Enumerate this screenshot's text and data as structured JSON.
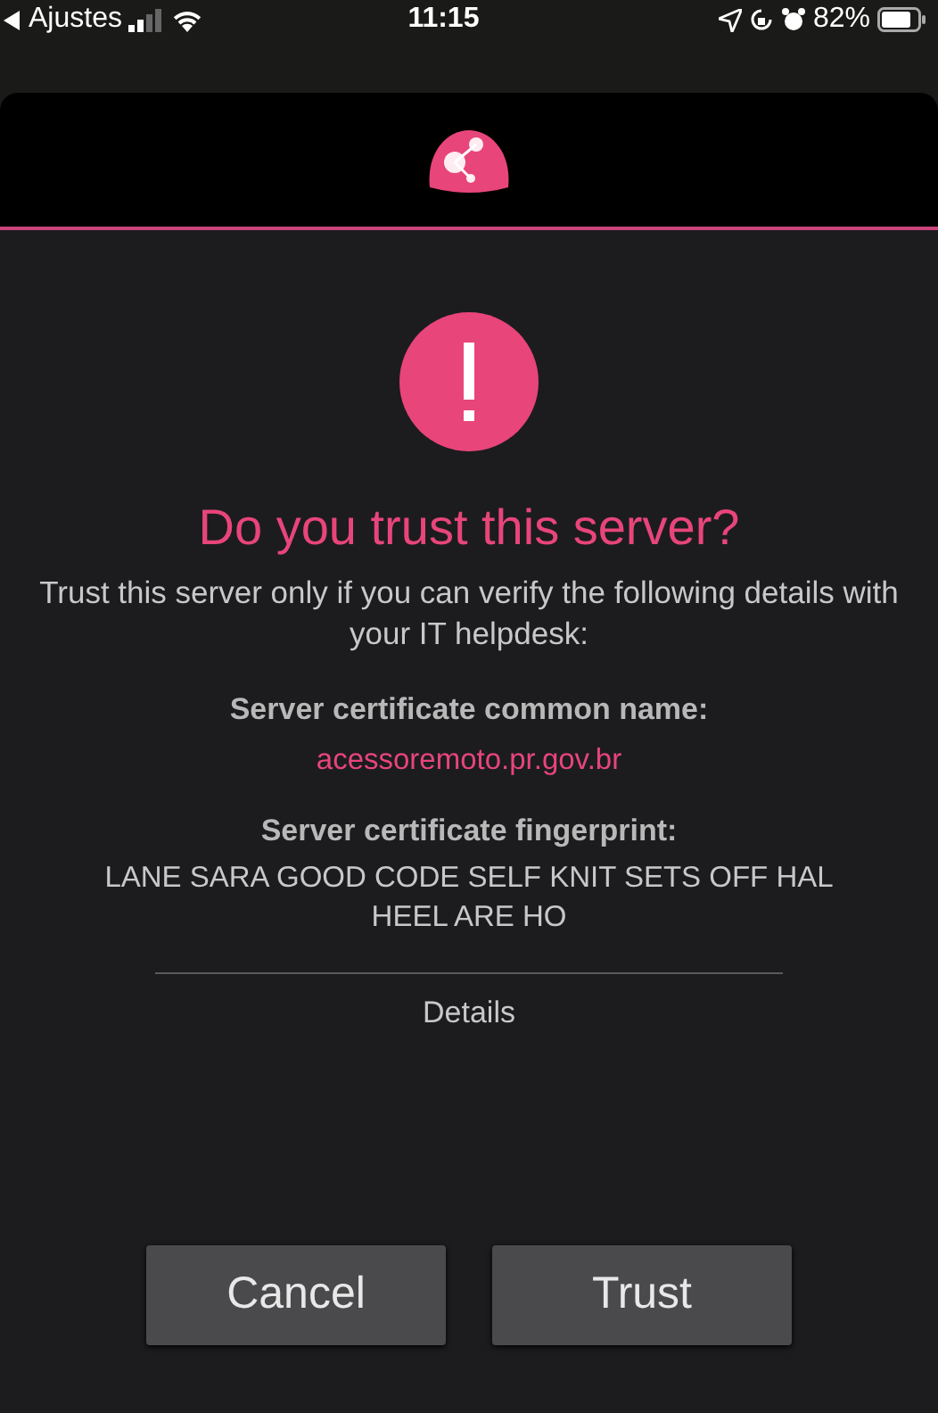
{
  "status_bar": {
    "back_app": "Ajustes",
    "time": "11:15",
    "battery_percent": "82%"
  },
  "dialog": {
    "title": "Do you trust this server?",
    "message": "Trust this server only if you can verify the following details with your IT helpdesk:",
    "fields": [
      {
        "label": "Server certificate common name:",
        "value": "acessoremoto.pr.gov.br",
        "kind": "link"
      },
      {
        "label": "Server certificate fingerprint:",
        "value": "LANE SARA GOOD CODE SELF KNIT SETS OFF HAL HEEL ARE HO",
        "kind": "plain"
      }
    ],
    "details": "Details",
    "buttons": [
      "Cancel",
      "Trust"
    ]
  }
}
